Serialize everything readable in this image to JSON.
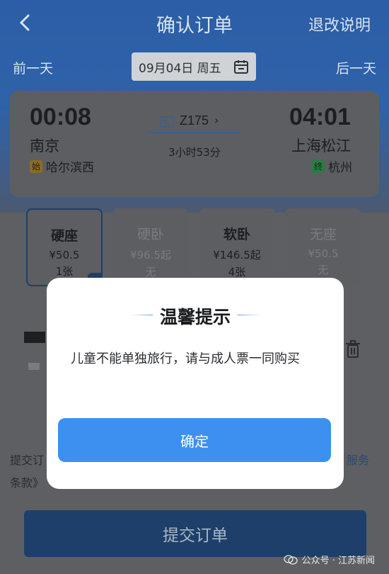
{
  "header": {
    "title": "确认订单",
    "help_link": "退改说明"
  },
  "date_nav": {
    "prev": "前一天",
    "date": "09月04日 周五",
    "next": "后一天"
  },
  "trip": {
    "departure_time": "00:08",
    "arrival_time": "04:01",
    "departure_station": "南京",
    "arrival_station": "上海松江",
    "origin_badge": "始",
    "origin_station": "哈尔滨西",
    "terminus_badge": "终",
    "terminus_station": "杭州",
    "train_number": "Z175",
    "duration": "3小时53分"
  },
  "seats": [
    {
      "name": "硬座",
      "price": "¥50.5",
      "availability": "1张",
      "selected": true,
      "enabled": true
    },
    {
      "name": "硬卧",
      "price": "¥96.5起",
      "availability": "无",
      "selected": false,
      "enabled": false
    },
    {
      "name": "软卧",
      "price": "¥146.5起",
      "availability": "4张",
      "selected": false,
      "enabled": true
    },
    {
      "name": "无座",
      "price": "¥50.5",
      "availability": "无",
      "selected": false,
      "enabled": false
    }
  ],
  "agreement": {
    "line1": "提交订",
    "line2": "条款》",
    "link": "服务"
  },
  "submit_label": "提交订单",
  "watermark": "公众号 · 江苏新闻",
  "modal": {
    "title": "温馨提示",
    "message": "儿童不能单独旅行，请与成人票一同购买",
    "confirm_label": "确定"
  },
  "colors": {
    "accent": "#3d90f0",
    "header_blue": "#2e62a9",
    "overlay": "#5e5f62"
  }
}
